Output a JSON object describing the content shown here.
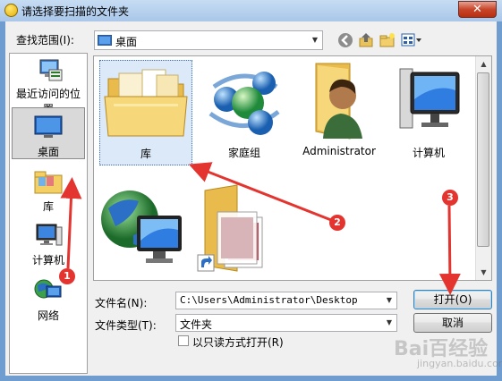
{
  "window": {
    "title": "请选择要扫描的文件夹",
    "close_glyph": "✕"
  },
  "lookin": {
    "label": "查找范围(I):",
    "value": "桌面"
  },
  "places": [
    {
      "label": "最近访问的位置",
      "icon": "recent-places-icon"
    },
    {
      "label": "桌面",
      "icon": "desktop-icon",
      "selected": true
    },
    {
      "label": "库",
      "icon": "library-icon"
    },
    {
      "label": "计算机",
      "icon": "computer-icon"
    },
    {
      "label": "网络",
      "icon": "network-icon"
    }
  ],
  "items": [
    {
      "label": "库",
      "icon": "library-folder-icon",
      "selected": true
    },
    {
      "label": "家庭组",
      "icon": "homegroup-icon"
    },
    {
      "label": "Administrator",
      "icon": "user-folder-icon"
    },
    {
      "label": "计算机",
      "icon": "computer-icon"
    },
    {
      "label": "",
      "icon": "network-globe-icon"
    },
    {
      "label": "",
      "icon": "shortcut-folder-icon"
    }
  ],
  "filename": {
    "label": "文件名(N):",
    "value": "C:\\Users\\Administrator\\Desktop"
  },
  "filetype": {
    "label": "文件类型(T):",
    "value": "文件夹"
  },
  "readonly": {
    "label": "以只读方式打开(R)",
    "checked": false
  },
  "buttons": {
    "open": "打开(O)",
    "cancel": "取消"
  },
  "annotations": [
    "1",
    "2",
    "3"
  ],
  "watermark": {
    "brand": "Bai百经验",
    "url": "jingyan.baidu.com"
  },
  "colors": {
    "annotation": "#e3342f",
    "selection": "#dbe9f9",
    "title_bar": "#a9c6e9"
  }
}
